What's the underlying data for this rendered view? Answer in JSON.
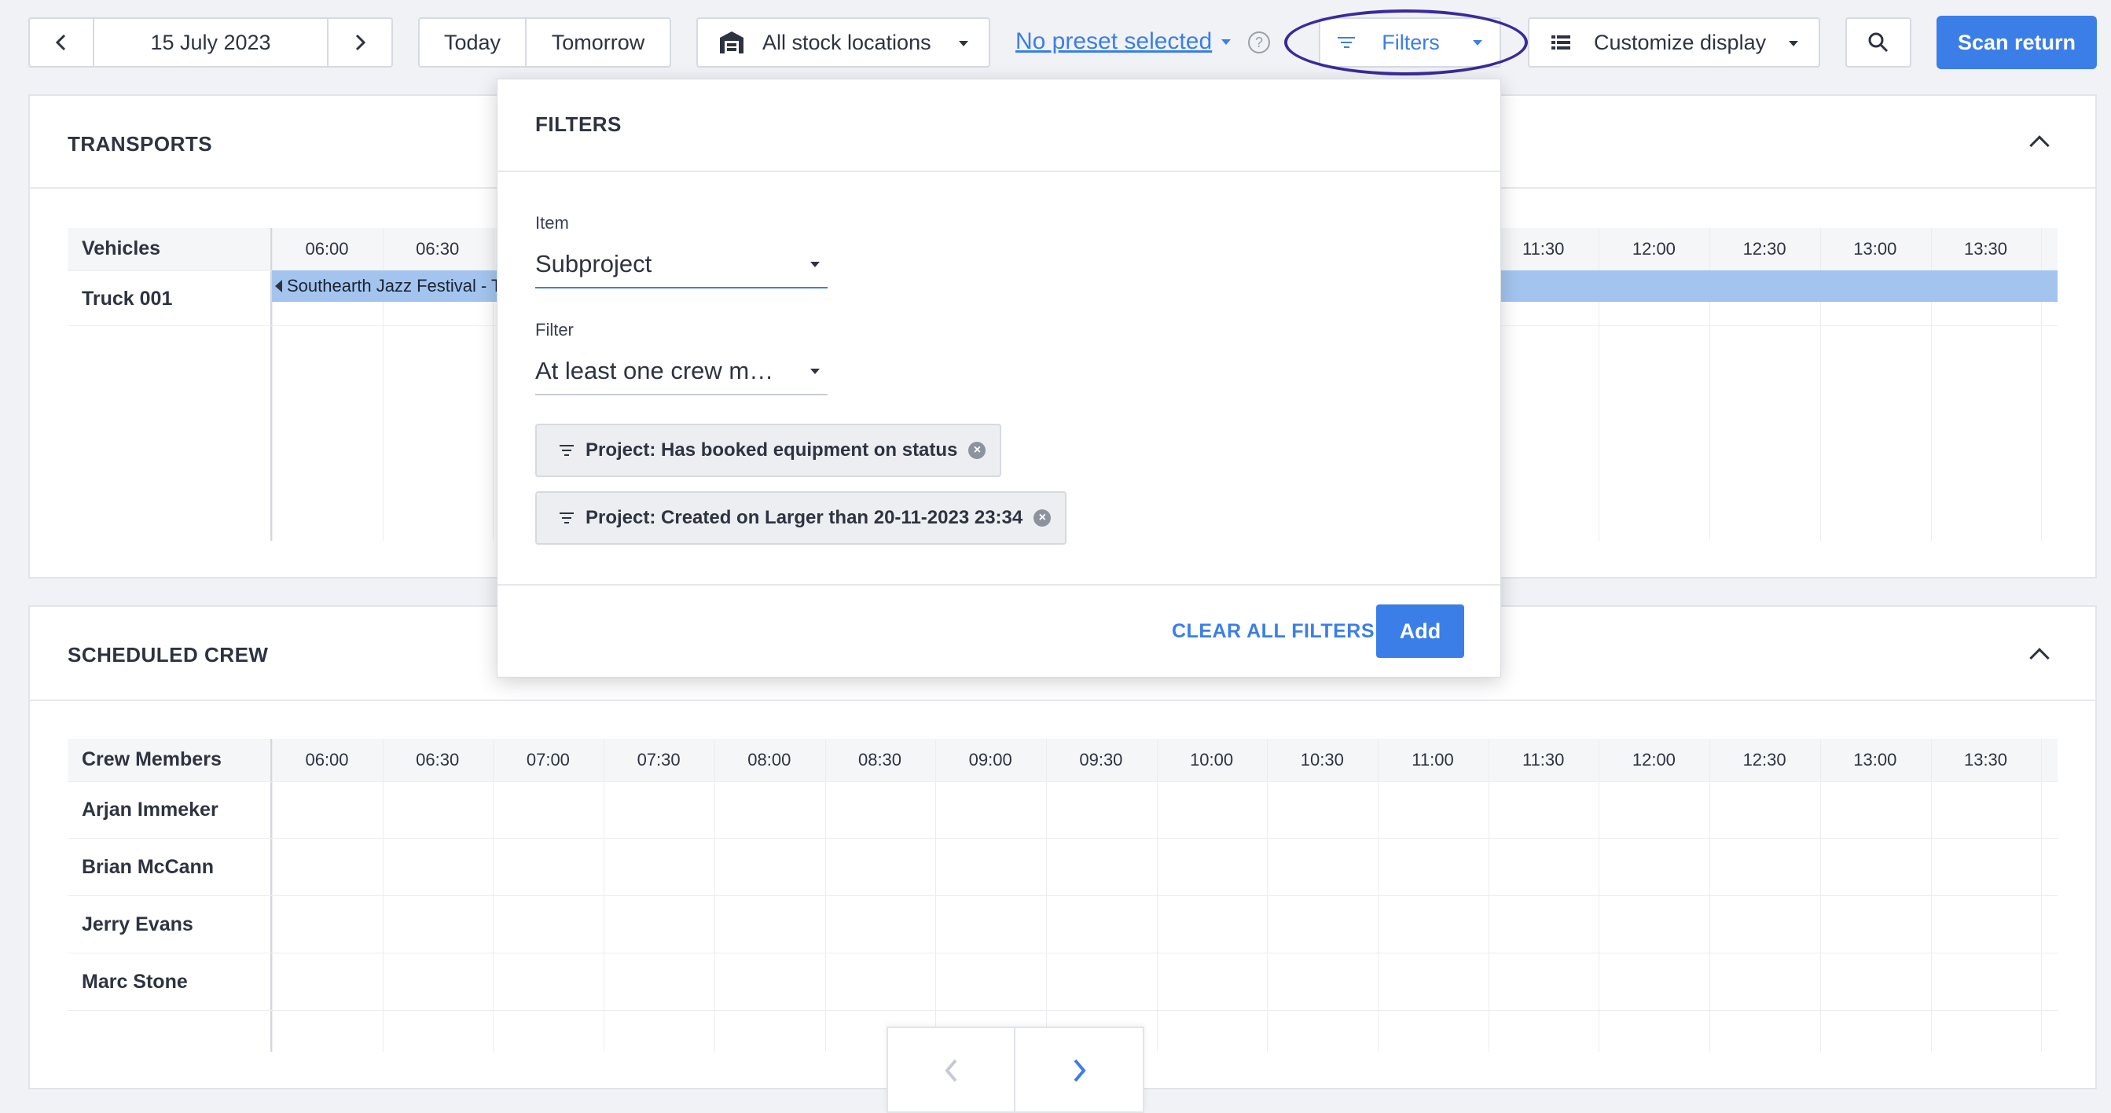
{
  "toolbar": {
    "date": "15 July 2023",
    "today": "Today",
    "tomorrow": "Tomorrow",
    "stock_locations": "All stock locations",
    "preset": "No preset selected",
    "filters": "Filters",
    "customize": "Customize display",
    "scan_return": "Scan return"
  },
  "transports": {
    "title": "TRANSPORTS",
    "header_label": "Vehicles",
    "rows": [
      {
        "name": "Truck 001",
        "event": "Southearth Jazz Festival - T"
      }
    ],
    "times": [
      "06:00",
      "06:30",
      "11:30",
      "12:00",
      "12:30",
      "13:00",
      "13:30"
    ]
  },
  "crew": {
    "title": "SCHEDULED CREW",
    "header_label": "Crew Members",
    "times": [
      "06:00",
      "06:30",
      "07:00",
      "07:30",
      "08:00",
      "08:30",
      "09:00",
      "09:30",
      "10:00",
      "10:30",
      "11:00",
      "11:30",
      "12:00",
      "12:30",
      "13:00",
      "13:30"
    ],
    "members": [
      "Arjan Immeker",
      "Brian McCann",
      "Jerry Evans",
      "Marc Stone"
    ]
  },
  "filters_panel": {
    "title": "FILTERS",
    "item_label": "Item",
    "item_value": "Subproject",
    "filter_label": "Filter",
    "filter_value": "At least one crew me…",
    "chips": [
      "Project: Has booked equipment on status",
      "Project: Created on Larger than 20-11-2023 23:34"
    ],
    "clear_all": "CLEAR ALL FILTERS",
    "add": "Add"
  },
  "colors": {
    "accent": "#3b7ee8",
    "highlight_ring": "#3a2a9a",
    "event_bar": "#a3c4ef"
  },
  "icons": [
    "chevron-left-icon",
    "chevron-right-icon",
    "warehouse-icon",
    "help-icon",
    "filter-icon",
    "list-icon",
    "search-icon",
    "close-circle-icon",
    "chevron-up-icon"
  ]
}
